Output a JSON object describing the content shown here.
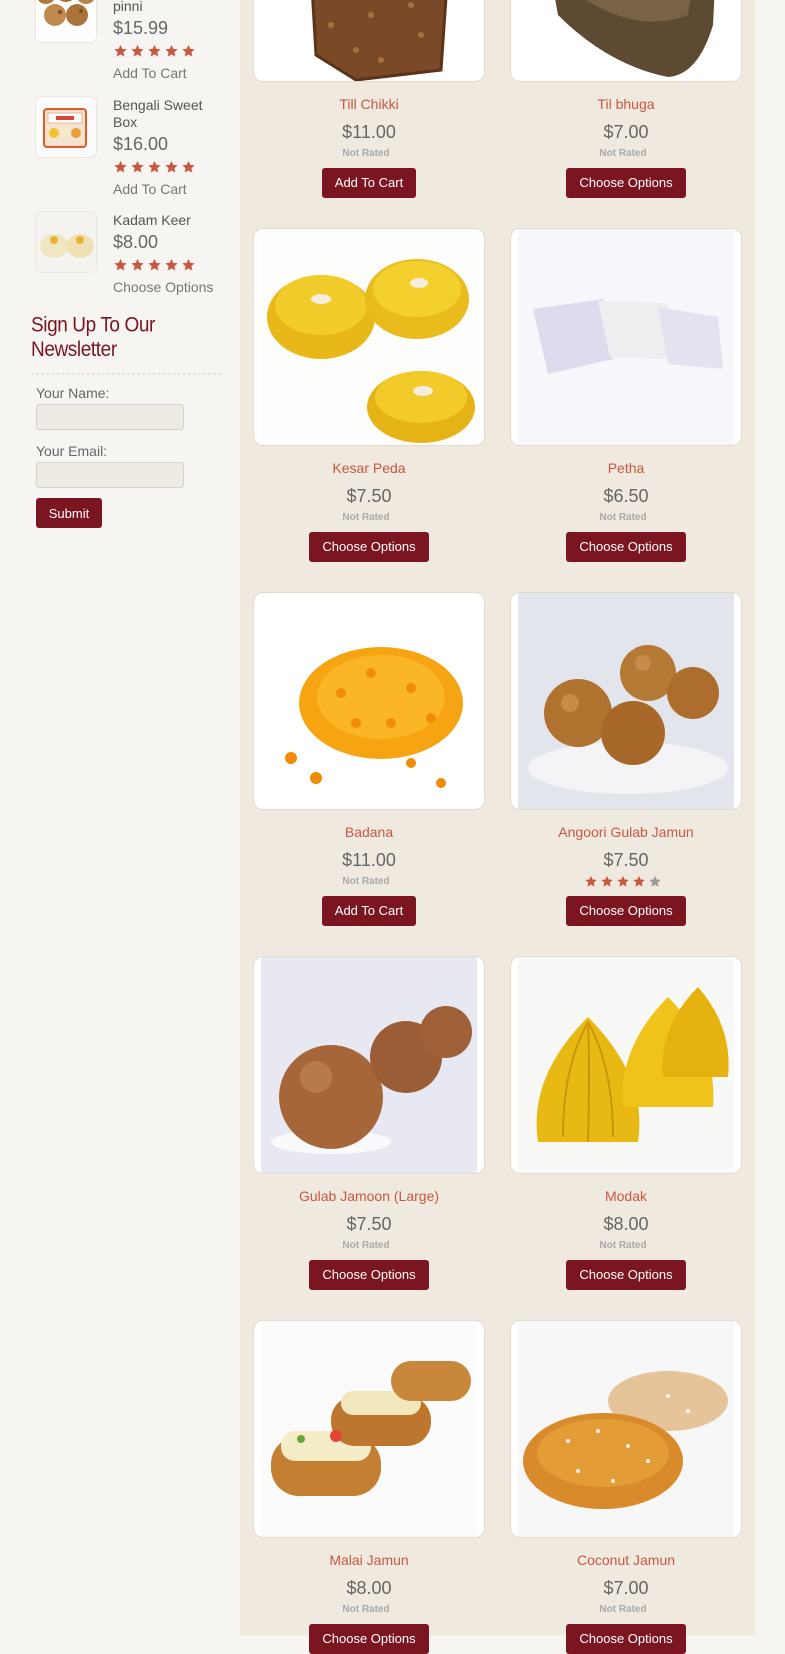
{
  "sidebar": {
    "items": [
      {
        "name": "pinni",
        "price": "$15.99",
        "rating": 5,
        "action": "Add To Cart",
        "thumb_icon": "laddu-thumbnail"
      },
      {
        "name": "Bengali Sweet Box",
        "price": "$16.00",
        "rating": 5,
        "action": "Add To Cart",
        "thumb_icon": "sweet-box-thumbnail"
      },
      {
        "name": "Kadam Keer",
        "price": "$8.00",
        "rating": 5,
        "action": "Choose Options",
        "thumb_icon": "kadam-keer-thumbnail"
      }
    ]
  },
  "newsletter": {
    "title": "Sign Up To Our Newsletter",
    "name_label": "Your Name:",
    "email_label": "Your Email:",
    "submit_label": "Submit"
  },
  "products": [
    {
      "name": "Till Chikki",
      "price": "$11.00",
      "rating_text": "Not Rated",
      "rating": 0,
      "button": "Add To Cart",
      "image_icon": "till-chikki-image"
    },
    {
      "name": "Til bhuga",
      "price": "$7.00",
      "rating_text": "Not Rated",
      "rating": 0,
      "button": "Choose Options",
      "image_icon": "til-bhuga-image"
    },
    {
      "name": "Kesar Peda",
      "price": "$7.50",
      "rating_text": "Not Rated",
      "rating": 0,
      "button": "Choose Options",
      "image_icon": "kesar-peda-image"
    },
    {
      "name": "Petha",
      "price": "$6.50",
      "rating_text": "Not Rated",
      "rating": 0,
      "button": "Choose Options",
      "image_icon": "petha-image"
    },
    {
      "name": "Badana",
      "price": "$11.00",
      "rating_text": "Not Rated",
      "rating": 0,
      "button": "Add To Cart",
      "image_icon": "badana-image"
    },
    {
      "name": "Angoori Gulab Jamun",
      "price": "$7.50",
      "rating_text": "",
      "rating": 4,
      "button": "Choose Options",
      "image_icon": "angoori-gulab-jamun-image"
    },
    {
      "name": "Gulab Jamoon (Large)",
      "price": "$7.50",
      "rating_text": "Not Rated",
      "rating": 0,
      "button": "Choose Options",
      "image_icon": "gulab-jamoon-image"
    },
    {
      "name": "Modak",
      "price": "$8.00",
      "rating_text": "Not Rated",
      "rating": 0,
      "button": "Choose Options",
      "image_icon": "modak-image"
    },
    {
      "name": "Malai Jamun",
      "price": "$8.00",
      "rating_text": "Not Rated",
      "rating": 0,
      "button": "Choose Options",
      "image_icon": "malai-jamun-image"
    },
    {
      "name": "Coconut Jamun",
      "price": "$7.00",
      "rating_text": "Not Rated",
      "rating": 0,
      "button": "Choose Options",
      "image_icon": "coconut-jamun-image"
    }
  ],
  "colors": {
    "accent": "#7b1520",
    "link": "#c8583f",
    "star": "#c8583f",
    "star_empty": "#9a9a9a",
    "page_bg": "#f7f5f1",
    "content_bg": "#efe9df"
  }
}
